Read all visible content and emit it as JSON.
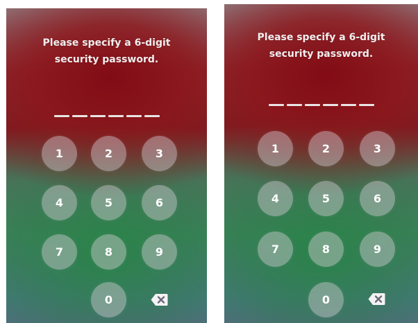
{
  "screens": [
    {
      "prompt": [
        "Please specify a 6-digit",
        "security password."
      ],
      "keys": [
        "1",
        "2",
        "3",
        "4",
        "5",
        "6",
        "7",
        "8",
        "9",
        "0"
      ],
      "delete_icon": "backspace-icon"
    },
    {
      "prompt": [
        "Please specify a 6-digit",
        "security password."
      ],
      "keys": [
        "1",
        "2",
        "3",
        "4",
        "5",
        "6",
        "7",
        "8",
        "9",
        "0"
      ],
      "delete_icon": "backspace-icon"
    }
  ],
  "colors": {
    "top_tint": "#7a1f24",
    "bottom_tint": "#3c8a5a",
    "key_fill": "rgba(210,205,210,0.45)"
  }
}
